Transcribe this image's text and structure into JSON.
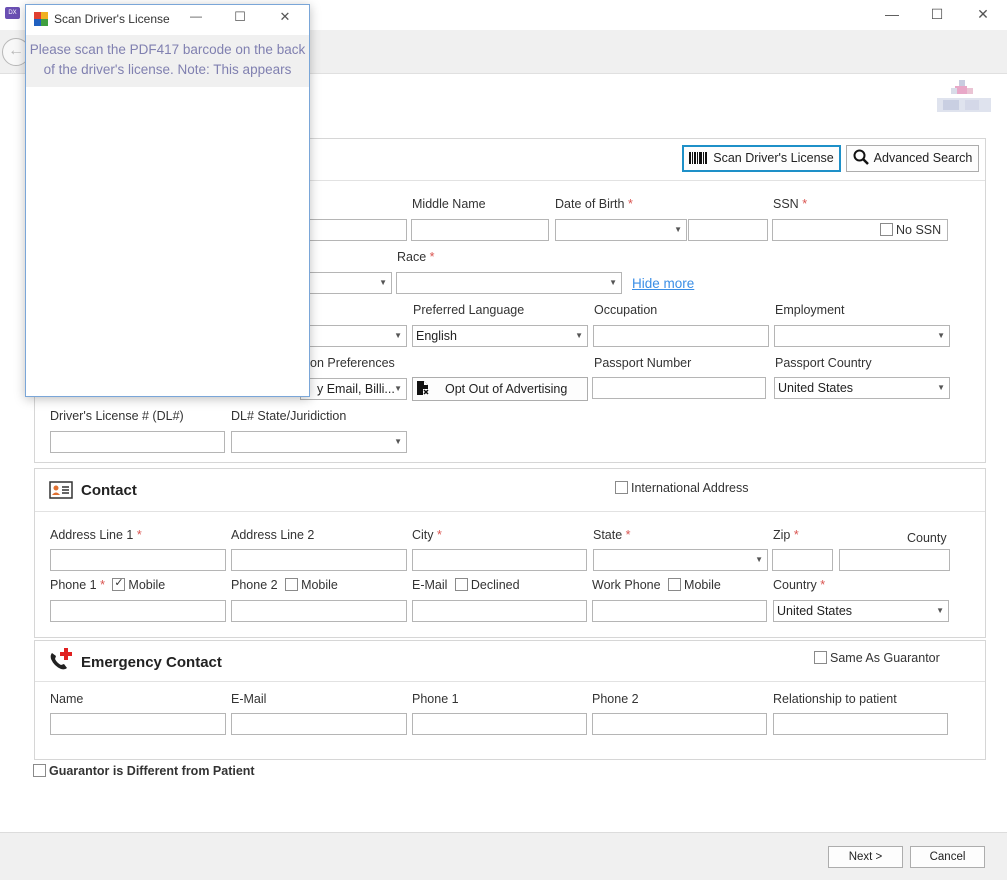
{
  "window": {
    "minimize": "—",
    "maximize": "☐",
    "close": "✕"
  },
  "toolbar": {
    "back": "←"
  },
  "patient": {
    "scan_button": "Scan Driver's License",
    "advanced_search_button": "Advanced Search",
    "middle_name_label": "Middle Name",
    "dob_label": "Date of Birth",
    "ssn_label": "SSN",
    "no_ssn_label": "No SSN",
    "race_label": "Race",
    "hide_more_link": "Hide more",
    "preferred_language_label": "Preferred Language",
    "preferred_language_value": "English",
    "occupation_label": "Occupation",
    "employment_label": "Employment",
    "communication_pref_label": "on Preferences",
    "communication_pref_value": "y Email, Billi...",
    "opt_out_button": "Opt Out of Advertising",
    "passport_number_label": "Passport Number",
    "passport_country_label": "Passport Country",
    "passport_country_value": "United States",
    "dl_number_label": "Driver's License # (DL#)",
    "dl_state_label": "DL# State/Juridiction",
    "required_mark": "*"
  },
  "contact": {
    "title": "Contact",
    "international_label": "International Address",
    "address1_label": "Address Line 1",
    "address2_label": "Address Line 2",
    "city_label": "City",
    "state_label": "State",
    "zip_label": "Zip",
    "county_label": "County",
    "phone1_label": "Phone 1",
    "phone1_mobile_label": "Mobile",
    "phone2_label": "Phone 2",
    "phone2_mobile_label": "Mobile",
    "email_label": "E-Mail",
    "declined_label": "Declined",
    "work_phone_label": "Work Phone",
    "work_mobile_label": "Mobile",
    "country_label": "Country",
    "country_value": "United States"
  },
  "emergency": {
    "title": "Emergency Contact",
    "same_as_guarantor_label": "Same As Guarantor",
    "name_label": "Name",
    "email_label": "E-Mail",
    "phone1_label": "Phone 1",
    "phone2_label": "Phone 2",
    "relationship_label": "Relationship to patient"
  },
  "guarantor_different_label": "Guarantor is Different from Patient",
  "footer": {
    "next_button": "Next >",
    "cancel_button": "Cancel"
  },
  "dialog": {
    "title": "Scan Driver's License",
    "minimize": "—",
    "maximize": "☐",
    "close": "✕",
    "message": "Please scan the PDF417 barcode on the back of the driver's license. Note: This appears"
  },
  "colors": {
    "required": "#d9534f",
    "link": "#3a8ee6",
    "scan_button_border": "#1e90c8",
    "dialog_message": "#8080b0",
    "emergency_cross": "#e02020"
  }
}
